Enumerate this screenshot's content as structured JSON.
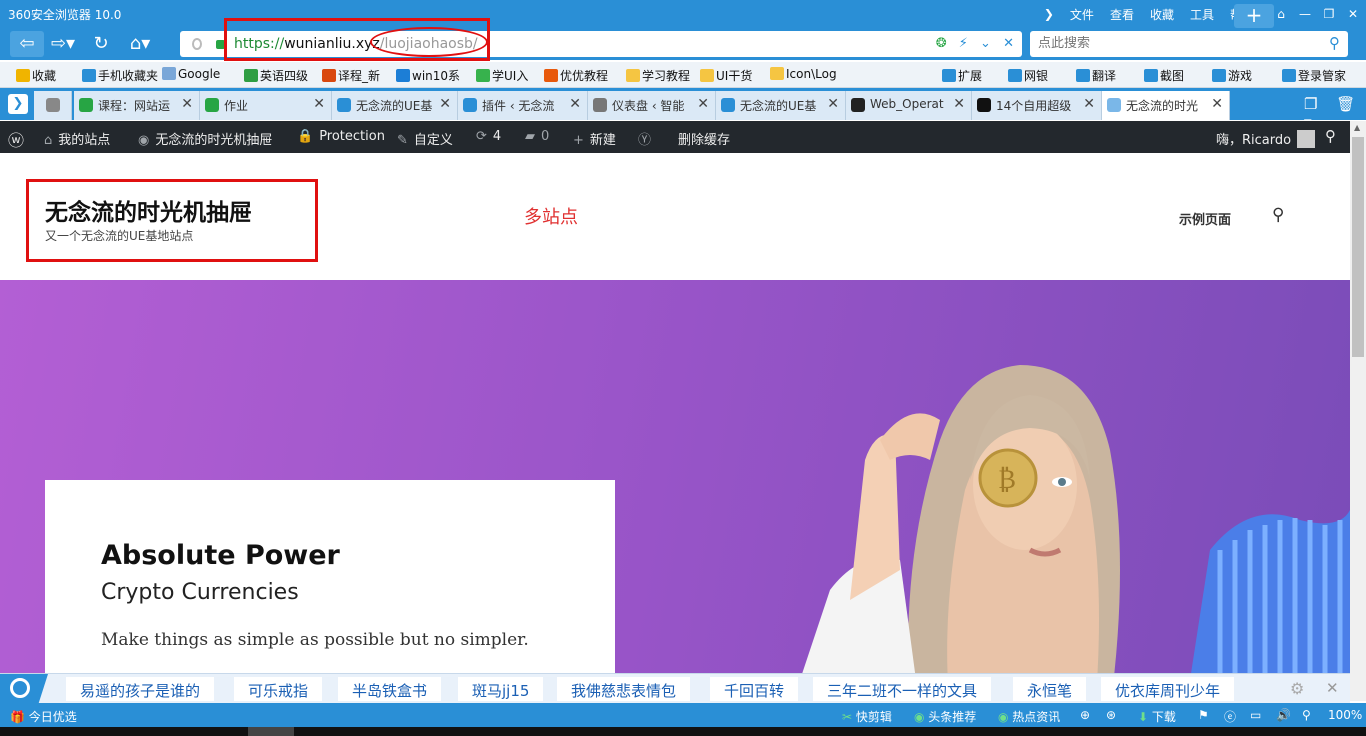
{
  "browser": {
    "title": "360安全浏览器 10.0",
    "menus": [
      "文件",
      "查看",
      "收藏",
      "工具",
      "帮助"
    ],
    "url_proto": "https://",
    "url_host": "wunianliu.xyz",
    "url_path": "/luojiaohaosb/",
    "search_placeholder": "点此搜索"
  },
  "bookmarks": [
    {
      "label": "收藏",
      "icon": "star-icon",
      "color": "#f0b400"
    },
    {
      "label": "手机收藏夹",
      "icon": "phone-icon",
      "color": "#2a8fd6"
    },
    {
      "label": "Google",
      "icon": "google-icon",
      "color": "#7aa7d8"
    },
    {
      "label": "英语四级",
      "icon": "leaf-icon",
      "color": "#2f9e44"
    },
    {
      "label": "译程_新",
      "icon": "translate-icon",
      "color": "#d9480f"
    },
    {
      "label": "win10系",
      "icon": "windows-icon",
      "color": "#1c7ed6"
    },
    {
      "label": "学UI入",
      "icon": "heart-icon",
      "color": "#37b24d"
    },
    {
      "label": "优优教程",
      "icon": "tiger-icon",
      "color": "#e8590c"
    },
    {
      "label": "学习教程",
      "icon": "folder-icon",
      "color": "#f5c542"
    },
    {
      "label": "UI干货",
      "icon": "folder-icon",
      "color": "#f5c542"
    },
    {
      "label": "Icon\\Log",
      "icon": "folder-icon",
      "color": "#f5c542"
    }
  ],
  "bookmark_tools": [
    {
      "label": "扩展",
      "icon": "grid-icon"
    },
    {
      "label": "网银",
      "icon": "shield-icon"
    },
    {
      "label": "翻译",
      "icon": "translate-icon"
    },
    {
      "label": "截图",
      "icon": "scissors-icon"
    },
    {
      "label": "游戏",
      "icon": "gamepad-icon"
    },
    {
      "label": "登录管家",
      "icon": "key-icon"
    }
  ],
  "tabs": [
    {
      "label": "课程：网站运",
      "icon_color": "#27a544"
    },
    {
      "label": "作业",
      "icon_color": "#27a544"
    },
    {
      "label": "无念流的UE基",
      "icon_color": "#2a8fd6"
    },
    {
      "label": "插件 ‹ 无念流",
      "icon_color": "#2a8fd6"
    },
    {
      "label": "仪表盘 ‹ 智能",
      "icon_color": "#777"
    },
    {
      "label": "无念流的UE基",
      "icon_color": "#2a8fd6"
    },
    {
      "label": "Web_Operat",
      "icon_color": "#222"
    },
    {
      "label": "14个自用超级",
      "icon_color": "#111"
    },
    {
      "label": "无念流的时光",
      "icon_color": "#7ab7e8"
    }
  ],
  "adminbar": {
    "my_sites": "我的站点",
    "site_name": "无念流的时光机抽屉",
    "protection": "Protection",
    "customize": "自定义",
    "updates": "4",
    "comments": "0",
    "new": "新建",
    "purge": "删除缓存",
    "greeting": "嗨，Ricardo"
  },
  "site": {
    "title": "无念流的时光机抽屉",
    "description": "又一个无念流的UE基地站点",
    "annotation": "多站点",
    "nav_item": "示例页面"
  },
  "hero": {
    "heading": "Absolute Power",
    "subheading": "Crypto Currencies",
    "text": "Make things as simple as possible but no simpler."
  },
  "hotwords": [
    "易遥的孩子是谁的",
    "可乐戒指",
    "半岛铁盒书",
    "斑马jj15",
    "我佛慈悲表情包",
    "千回百转",
    "三年二班不一样的文具",
    "永恒笔",
    "优衣库周刊少年"
  ],
  "statusbar": {
    "left": "今日优选",
    "items": [
      "快剪辑",
      "头条推荐",
      "热点资讯",
      "下载"
    ],
    "zoom": "100%"
  },
  "colors": {
    "browser_blue": "#2a8fd6",
    "admin_bar": "#23282d",
    "hero_purple": "#9a55c9",
    "annotation_red": "#e01010"
  }
}
